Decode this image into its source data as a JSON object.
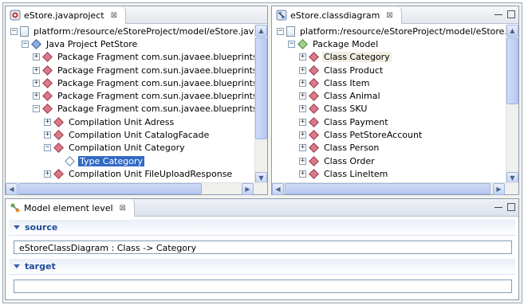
{
  "left_editor": {
    "tab_label": "eStore.javaproject",
    "close_glyph": "⊠",
    "tree": [
      {
        "indent": 0,
        "exp": "−",
        "icon": "file",
        "label": "platform:/resource/eStoreProject/model/eStore.javaproj"
      },
      {
        "indent": 1,
        "exp": "−",
        "icon": "diamond-blue",
        "label": "Java Project PetStore"
      },
      {
        "indent": 2,
        "exp": "+",
        "icon": "diamond-red",
        "label": "Package Fragment com.sun.javaee.blueprints.pe"
      },
      {
        "indent": 2,
        "exp": "+",
        "icon": "diamond-red",
        "label": "Package Fragment com.sun.javaee.blueprints.pe"
      },
      {
        "indent": 2,
        "exp": "+",
        "icon": "diamond-red",
        "label": "Package Fragment com.sun.javaee.blueprints.pe"
      },
      {
        "indent": 2,
        "exp": "+",
        "icon": "diamond-red",
        "label": "Package Fragment com.sun.javaee.blueprints.pe"
      },
      {
        "indent": 2,
        "exp": "−",
        "icon": "diamond-red",
        "label": "Package Fragment com.sun.javaee.blueprints.pe"
      },
      {
        "indent": 3,
        "exp": "+",
        "icon": "diamond-red",
        "label": "Compilation Unit Adress"
      },
      {
        "indent": 3,
        "exp": "+",
        "icon": "diamond-red",
        "label": "Compilation Unit CatalogFacade"
      },
      {
        "indent": 3,
        "exp": "−",
        "icon": "diamond-red",
        "label": "Compilation Unit Category"
      },
      {
        "indent": 4,
        "exp": "",
        "icon": "diamond-white",
        "label": "Type Category",
        "selected": true
      },
      {
        "indent": 3,
        "exp": "+",
        "icon": "diamond-red",
        "label": "Compilation Unit FileUploadResponse"
      }
    ]
  },
  "right_editor": {
    "tab_label": "eStore.classdiagram",
    "close_glyph": "⊠",
    "tree": [
      {
        "indent": 0,
        "exp": "−",
        "icon": "file",
        "label": "platform:/resource/eStoreProject/model/eStore.classdiag"
      },
      {
        "indent": 1,
        "exp": "−",
        "icon": "diamond-green",
        "label": "Package Model"
      },
      {
        "indent": 2,
        "exp": "+",
        "icon": "diamond-red",
        "label": "Class Category",
        "highlight": true
      },
      {
        "indent": 2,
        "exp": "+",
        "icon": "diamond-red",
        "label": "Class Product"
      },
      {
        "indent": 2,
        "exp": "+",
        "icon": "diamond-red",
        "label": "Class Item"
      },
      {
        "indent": 2,
        "exp": "+",
        "icon": "diamond-red",
        "label": "Class Animal"
      },
      {
        "indent": 2,
        "exp": "+",
        "icon": "diamond-red",
        "label": "Class SKU"
      },
      {
        "indent": 2,
        "exp": "+",
        "icon": "diamond-red",
        "label": "Class Payment"
      },
      {
        "indent": 2,
        "exp": "+",
        "icon": "diamond-red",
        "label": "Class PetStoreAccount"
      },
      {
        "indent": 2,
        "exp": "+",
        "icon": "diamond-red",
        "label": "Class Person"
      },
      {
        "indent": 2,
        "exp": "+",
        "icon": "diamond-red",
        "label": "Class Order"
      },
      {
        "indent": 2,
        "exp": "+",
        "icon": "diamond-red",
        "label": "Class LineItem"
      }
    ]
  },
  "view": {
    "tab_label": "Model element level",
    "close_glyph": "⊠",
    "source": {
      "title": "source",
      "value": "eStoreClassDiagram : Class -> Category"
    },
    "target": {
      "title": "target",
      "value": ""
    }
  },
  "icons": {
    "editor_icon": "eclipse-editor-icon",
    "view_icon": "model-level-icon",
    "scroll_up": "▲",
    "scroll_down": "▼",
    "scroll_left": "◀",
    "scroll_right": "▶"
  },
  "colors": {
    "selection": "#316ac5",
    "section_title": "#1d4c9a"
  }
}
